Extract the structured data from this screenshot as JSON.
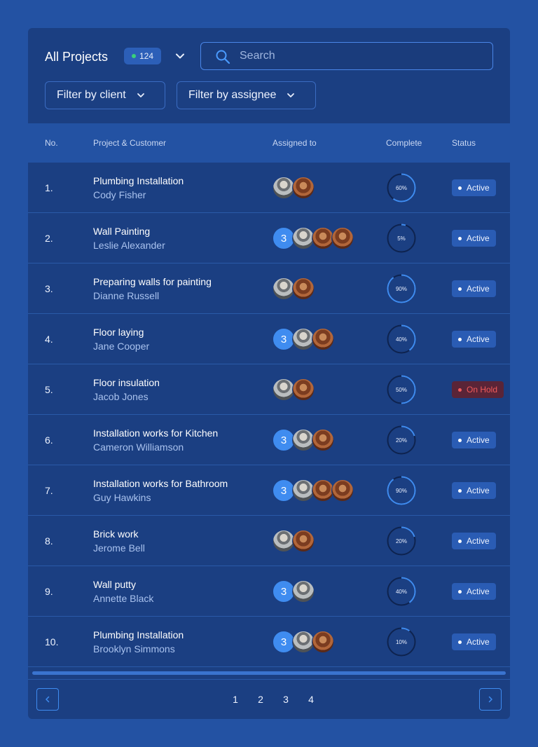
{
  "header": {
    "title": "All Projects",
    "count": "124",
    "search_placeholder": "Search",
    "filter_client": "Filter by client",
    "filter_assignee": "Filter by assignee"
  },
  "table": {
    "columns": [
      "No.",
      "Project & Customer",
      "Assigned to",
      "Complete",
      "Status"
    ],
    "rows": [
      {
        "no": "1.",
        "project": "Plumbing Installation",
        "customer": "Cody Fisher",
        "extra_count": "",
        "avatars": [
          "man",
          "woman"
        ],
        "complete": 0.6,
        "complete_label": "60%",
        "status": "Active"
      },
      {
        "no": "2.",
        "project": "Wall Painting",
        "customer": "Leslie Alexander",
        "extra_count": "3",
        "avatars": [
          "man",
          "woman",
          "woman"
        ],
        "complete": 0.05,
        "complete_label": "5%",
        "status": "Active"
      },
      {
        "no": "3.",
        "project": "Preparing walls for painting",
        "customer": "Dianne Russell",
        "extra_count": "",
        "avatars": [
          "man",
          "woman"
        ],
        "complete": 0.9,
        "complete_label": "90%",
        "status": "Active"
      },
      {
        "no": "4.",
        "project": "Floor laying",
        "customer": "Jane Cooper",
        "extra_count": "3",
        "avatars": [
          "man",
          "woman"
        ],
        "complete": 0.4,
        "complete_label": "40%",
        "status": "Active"
      },
      {
        "no": "5.",
        "project": "Floor insulation",
        "customer": "Jacob Jones",
        "extra_count": "",
        "avatars": [
          "man",
          "woman"
        ],
        "complete": 0.5,
        "complete_label": "50%",
        "status": "On Hold"
      },
      {
        "no": "6.",
        "project": "Installation works for Kitchen",
        "customer": "Cameron Williamson",
        "extra_count": "3",
        "avatars": [
          "man",
          "woman"
        ],
        "complete": 0.2,
        "complete_label": "20%",
        "status": "Active"
      },
      {
        "no": "7.",
        "project": "Installation works for Bathroom",
        "customer": "Guy Hawkins",
        "extra_count": "3",
        "avatars": [
          "man",
          "woman",
          "woman"
        ],
        "complete": 0.9,
        "complete_label": "90%",
        "status": "Active"
      },
      {
        "no": "8.",
        "project": "Brick work",
        "customer": "Jerome Bell",
        "extra_count": "",
        "avatars": [
          "man",
          "woman"
        ],
        "complete": 0.2,
        "complete_label": "20%",
        "status": "Active"
      },
      {
        "no": "9.",
        "project": "Wall putty",
        "customer": "Annette Black",
        "extra_count": "3",
        "avatars": [
          "man"
        ],
        "complete": 0.4,
        "complete_label": "40%",
        "status": "Active"
      },
      {
        "no": "10.",
        "project": "Plumbing Installation",
        "customer": "Brooklyn Simmons",
        "extra_count": "3",
        "avatars": [
          "man",
          "woman"
        ],
        "complete": 0.1,
        "complete_label": "10%",
        "status": "Active"
      }
    ]
  },
  "pagination": {
    "pages": [
      "1",
      "2",
      "3",
      "4"
    ]
  },
  "colors": {
    "accent": "#3f8cf0",
    "active_badge": "#2a5cb4",
    "hold_badge": "#5a2437",
    "hold_text": "#f15a5a"
  }
}
